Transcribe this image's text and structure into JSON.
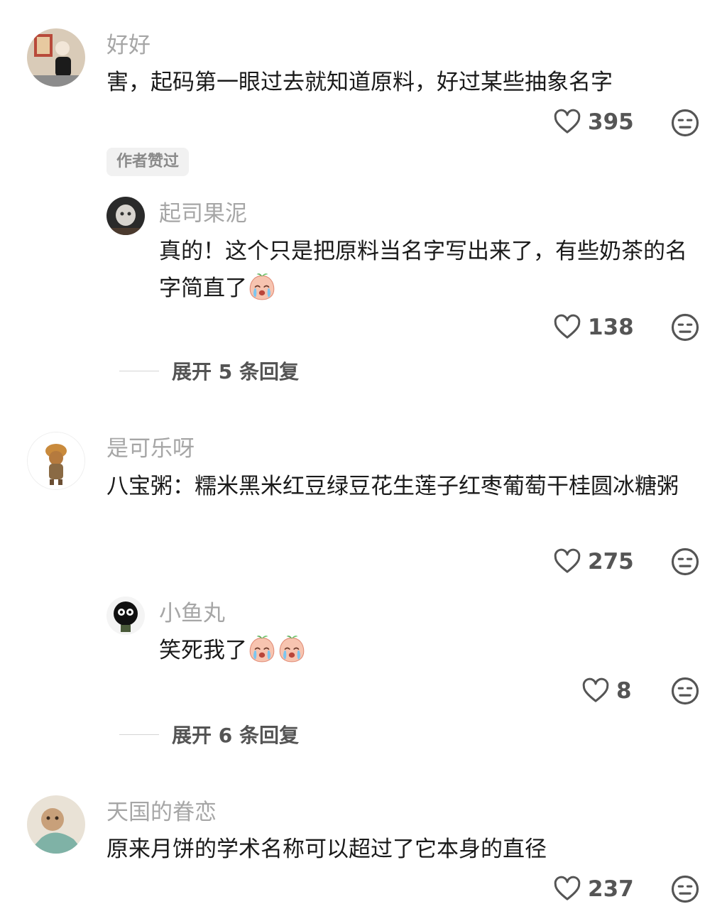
{
  "comments": [
    {
      "username": "好好",
      "text": "害，起码第一眼过去就知道原料，好过某些抽象名字",
      "likes": "395",
      "badge": "作者赞过",
      "replies": [
        {
          "username": "起司果泥",
          "text": "真的！这个只是把原料当名字写出来了，有些奶茶的名字简直了",
          "emoji": "crying-peach",
          "likes": "138"
        }
      ],
      "expand_label": "展开 5 条回复"
    },
    {
      "username": "是可乐呀",
      "text": "八宝粥：糯米黑米红豆绿豆花生莲子红枣葡萄干桂圆冰糖粥",
      "likes": "275",
      "replies": [
        {
          "username": "小鱼丸",
          "text": "笑死我了",
          "emoji": "crying-peach",
          "emoji_count": 2,
          "likes": "8"
        }
      ],
      "expand_label": "展开 6 条回复"
    },
    {
      "username": "天国的眷恋",
      "text": "原来月饼的学术名称可以超过了它本身的直径",
      "likes": "237"
    }
  ],
  "icons": {
    "like": "heart-outline-icon",
    "dislike": "meh-face-icon"
  },
  "colors": {
    "username": "#a6a6a6",
    "text": "#1a1a1a",
    "icon": "#555555",
    "badge_bg": "#f1f1f1"
  }
}
